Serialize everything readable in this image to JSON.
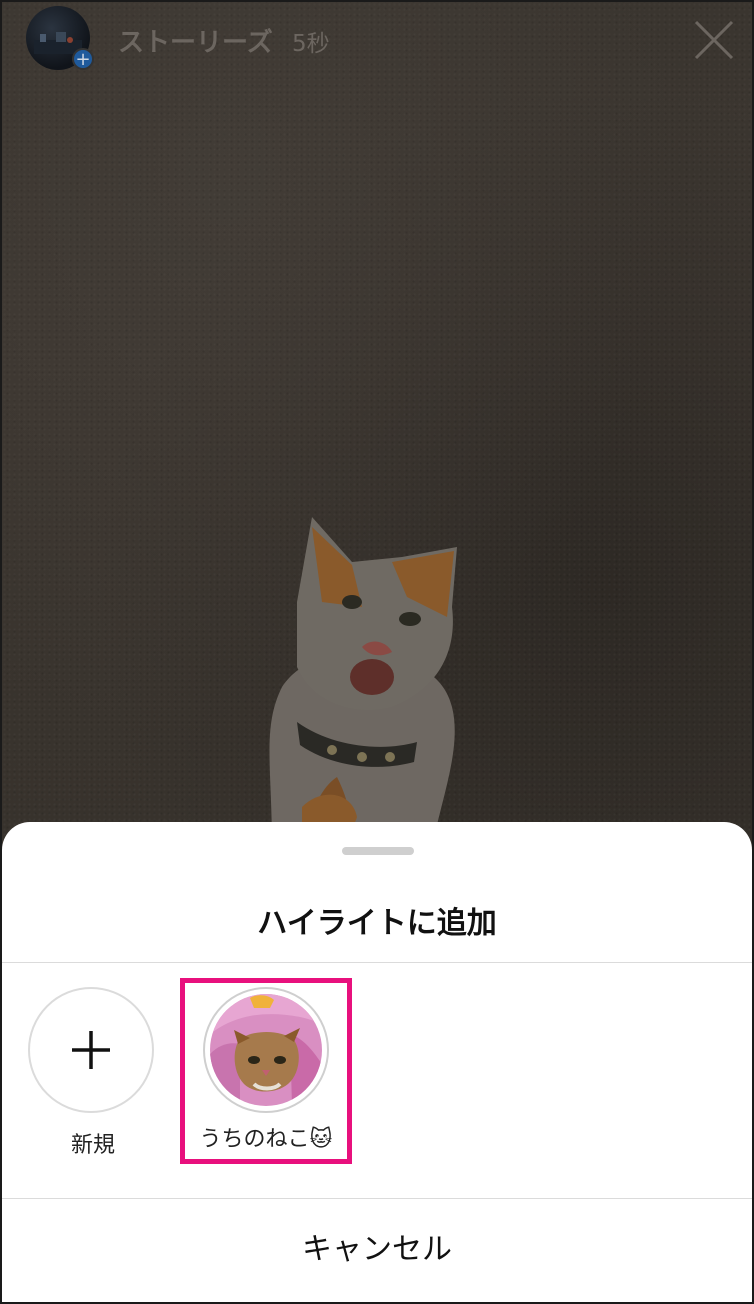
{
  "story": {
    "title": "ストーリーズ",
    "elapsed": "5秒"
  },
  "sheet": {
    "title": "ハイライトに追加",
    "new_label": "新規",
    "highlights": [
      {
        "label": "うちのねこ🐱",
        "selected": true
      }
    ],
    "cancel_label": "キャンセル"
  },
  "colors": {
    "selection_border": "#e8107d",
    "sheet_background": "#ffffff",
    "story_background": "#3b3631"
  },
  "icons": {
    "close": "close-icon",
    "plus": "plus-icon",
    "avatar_add": "add-badge-icon"
  }
}
